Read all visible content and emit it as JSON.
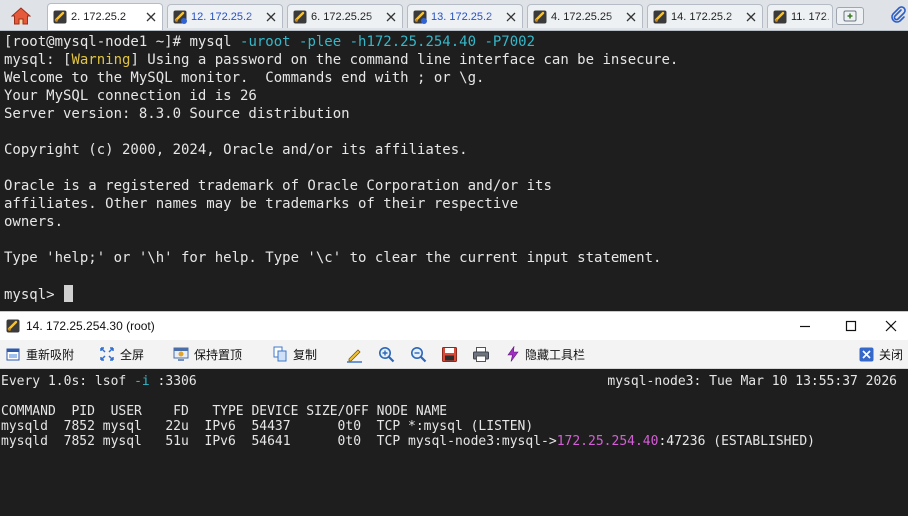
{
  "tabs": [
    {
      "label": "2. 172.25.2",
      "active": true,
      "blue": false
    },
    {
      "label": "12. 172.25.2",
      "active": false,
      "blue": true
    },
    {
      "label": "6. 172.25.25",
      "active": false,
      "blue": false
    },
    {
      "label": "13. 172.25.2",
      "active": false,
      "blue": true
    },
    {
      "label": "4. 172.25.25",
      "active": false,
      "blue": false
    },
    {
      "label": "14. 172.25.2",
      "active": false,
      "blue": false
    },
    {
      "label": "11. 172.",
      "active": false,
      "blue": false
    }
  ],
  "terminal": {
    "prompt": "[root@mysql-node1 ~]# ",
    "cmd_base": "mysql ",
    "cmd_args": "-uroot -plee -h172.25.254.40 -P7002",
    "warning_prefix": "mysql: [",
    "warning_word": "Warning",
    "warning_rest": "] Using a password on the command line interface can be insecure.",
    "lines": [
      "Welcome to the MySQL monitor.  Commands end with ; or \\g.",
      "Your MySQL connection id is 26",
      "Server version: 8.3.0 Source distribution",
      "",
      "Copyright (c) 2000, 2024, Oracle and/or its affiliates.",
      "",
      "Oracle is a registered trademark of Oracle Corporation and/or its",
      "affiliates. Other names may be trademarks of their respective",
      "owners.",
      "",
      "Type 'help;' or '\\h' for help. Type '\\c' to clear the current input statement."
    ],
    "mysql_prompt": "mysql> "
  },
  "pane": {
    "title": "14. 172.25.254.30 (root)",
    "toolbar": {
      "rename": "重新吸附",
      "fullscreen": "全屏",
      "keep_top": "保持置顶",
      "copy": "复制",
      "hide_toolbar": "隐藏工具栏",
      "close": "关闭"
    },
    "watch_prefix": "Every 1.0s: lsof ",
    "watch_flag": "-i",
    "watch_port": " :3306",
    "watch_status": "mysql-node3: Tue Mar 10 13:55:37 2026",
    "header": "COMMAND  PID  USER    FD   TYPE DEVICE SIZE/OFF NODE NAME",
    "row1": "mysqld  7852 mysql   22u  IPv6  54437      0t0  TCP *:mysql (LISTEN)",
    "row2_prefix": "mysqld  7852 mysql   51u  IPv6  54641      0t0  TCP mysql-node3:mysql->",
    "row2_ip": "172.25.254.40",
    "row2_suffix": ":47236 (ESTABLISHED)"
  }
}
